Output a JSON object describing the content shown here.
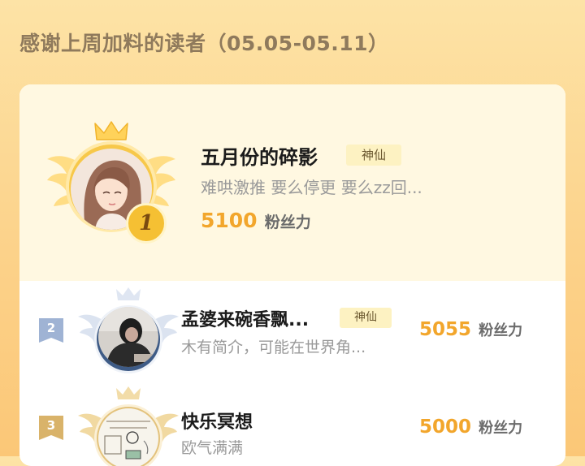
{
  "header": {
    "title": "感谢上周加料的读者（05.05-05.11）"
  },
  "ranking": [
    {
      "rank": "1",
      "name": "五月份的碎影",
      "tag": "神仙",
      "bio": "难哄激推 要么停更 要么zz回...",
      "score": "5100",
      "unit": "粉丝力"
    },
    {
      "rank": "2",
      "name": "孟婆来碗香飘...",
      "tag": "神仙",
      "bio": "木有简介，可能在世界角...",
      "score": "5055",
      "unit": "粉丝力"
    },
    {
      "rank": "3",
      "name": "快乐冥想",
      "bio": "欧气满满",
      "score": "5000",
      "unit": "粉丝力"
    }
  ],
  "colors": {
    "background": "#fcd28a",
    "title": "#8f7a5c",
    "score": "#f2a62c",
    "tag_bg": "#fdf2c2",
    "rank1": "#f5c033",
    "rank2": "#9fb3d4",
    "rank3": "#d9b36a"
  },
  "icons": {
    "crown": "crown-icon",
    "wings": "wings-icon",
    "rank_badge": "rank-flag-icon"
  }
}
